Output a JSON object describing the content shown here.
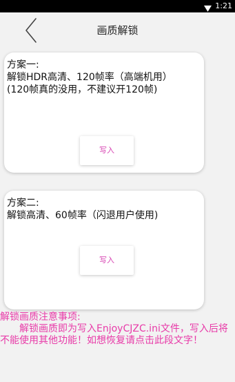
{
  "status_bar": {
    "time": "1:21",
    "icons": [
      "wifi-icon"
    ]
  },
  "header": {
    "title": "画质解锁",
    "back_icon": "chevron-left-icon"
  },
  "options": [
    {
      "title": "方案一:",
      "description": "解锁HDR高清、120帧率（高端机用）",
      "note": "(120帧真的没用，不建议开120帧)",
      "button_label": "写入"
    },
    {
      "title": "方案二:",
      "description": "解锁高清、60帧率（闪退用户使用)",
      "button_label": "写入"
    }
  ],
  "notes": {
    "title": "解锁画质注意事项:",
    "body": "解锁画质即为写入EnjoyCJZC.ini文件，写入后将不能使用其他功能！如想恢复请点击此段文字！"
  },
  "colors": {
    "accent": "#e83aa8",
    "button_text": "#d63fb0",
    "background": "#f2f2f2",
    "status_bar": "#000000"
  }
}
